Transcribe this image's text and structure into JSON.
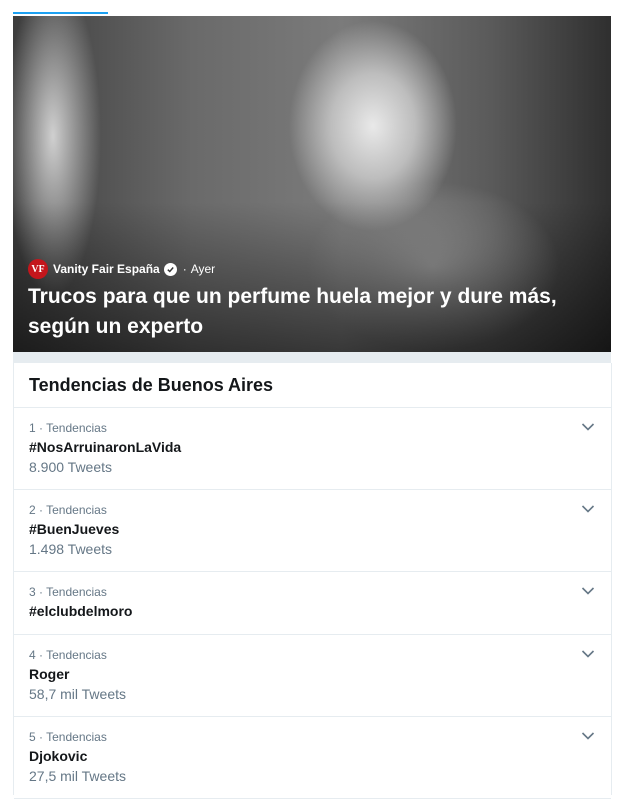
{
  "hero": {
    "source_logo_text": "VF",
    "author": "Vanity Fair España",
    "separator": "·",
    "time": "Ayer",
    "headline": "Trucos para que un perfume huela mejor y dure más, según un experto"
  },
  "trends": {
    "title": "Tendencias de Buenos Aires",
    "items": [
      {
        "meta": "1 · Tendencias",
        "name": "#NosArruinaronLaVida",
        "count": "8.900 Tweets"
      },
      {
        "meta": "2 · Tendencias",
        "name": "#BuenJueves",
        "count": "1.498 Tweets"
      },
      {
        "meta": "3 · Tendencias",
        "name": "#elclubdelmoro",
        "count": ""
      },
      {
        "meta": "4 · Tendencias",
        "name": "Roger",
        "count": "58,7 mil Tweets"
      },
      {
        "meta": "5 · Tendencias",
        "name": "Djokovic",
        "count": "27,5 mil Tweets"
      }
    ]
  },
  "colors": {
    "accent": "#1da1f2",
    "brand_red": "#c4161c",
    "muted_text": "#657786",
    "divider": "#e6ecf0"
  },
  "icons": {
    "verified": "verified-badge-icon",
    "expand": "chevron-down-icon"
  }
}
